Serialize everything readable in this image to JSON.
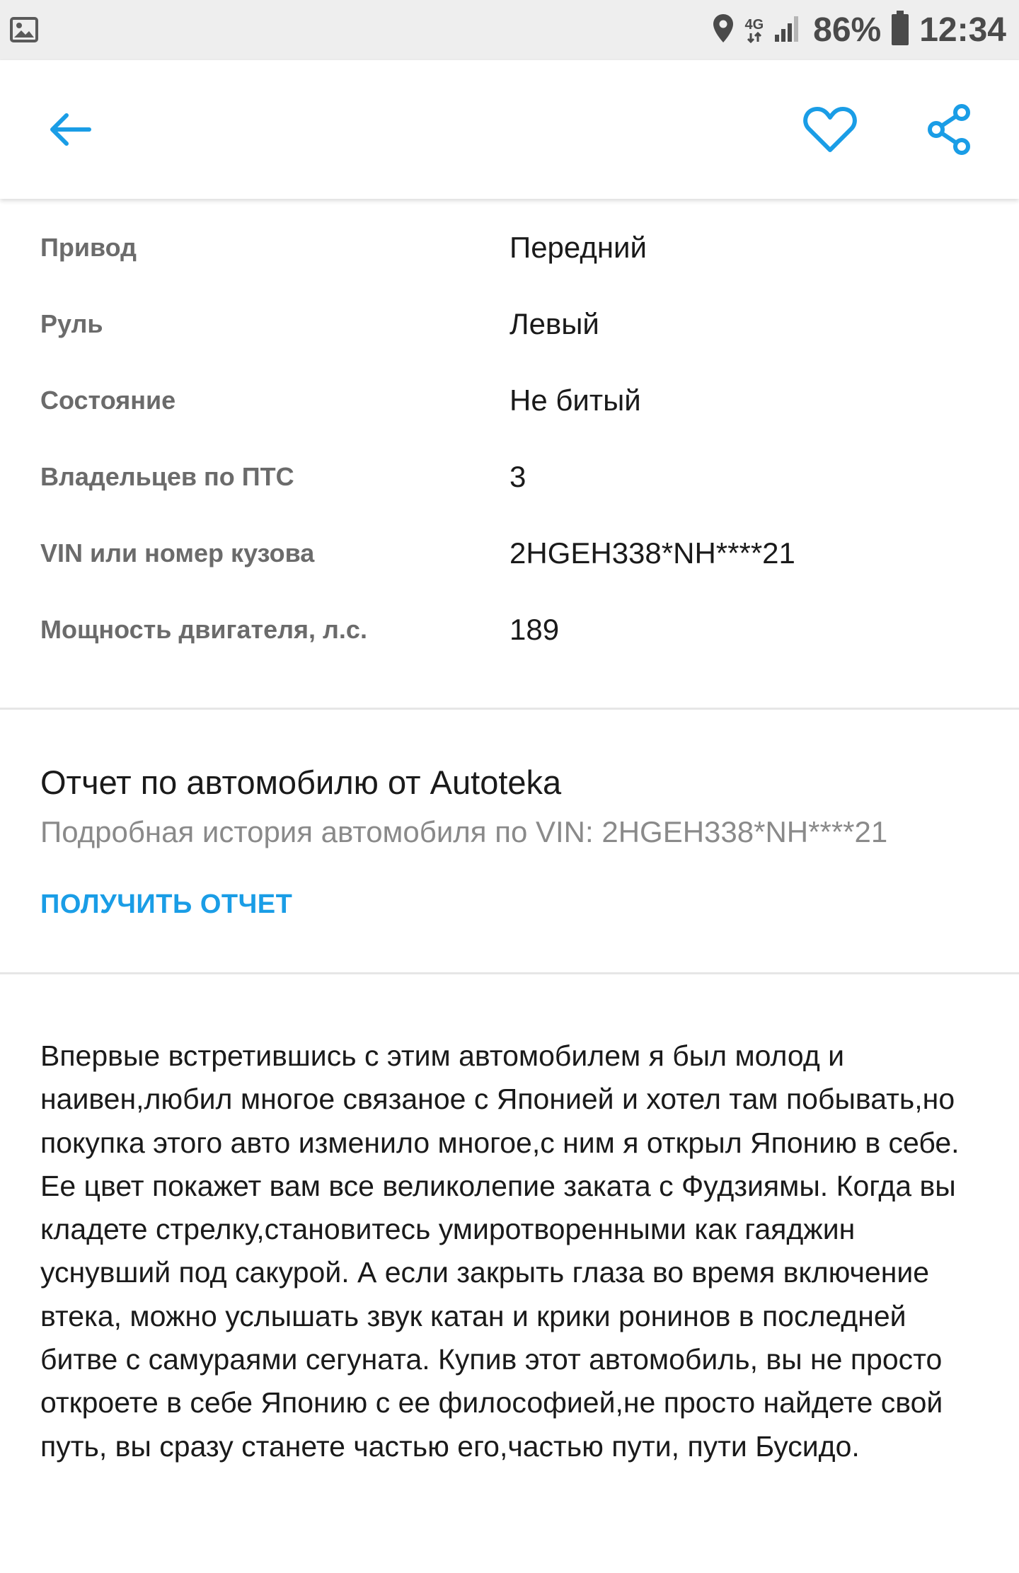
{
  "status_bar": {
    "battery": "86%",
    "time": "12:34",
    "network": "4G"
  },
  "app_bar": {
    "accent_color": "#1a9de6",
    "icons": [
      "arrow-back-icon",
      "heart-icon",
      "share-icon"
    ]
  },
  "specs": [
    {
      "label": "Привод",
      "value": "Передний"
    },
    {
      "label": "Руль",
      "value": "Левый"
    },
    {
      "label": "Состояние",
      "value": "Не битый"
    },
    {
      "label": "Владельцев по ПТС",
      "value": "3"
    },
    {
      "label": "VIN или номер кузова",
      "value": "2HGEH338*NH****21"
    },
    {
      "label": "Мощность двигателя, л.с.",
      "value": "189"
    }
  ],
  "report": {
    "title": "Отчет по автомобилю от Autoteka",
    "subtitle": "Подробная история автомобиля по VIN: 2HGEH338*NH****21",
    "action_label": "ПОЛУЧИТЬ ОТЧЕТ"
  },
  "description": {
    "paragraph_1": "Впервые встретившись с этим автомобилем я был молод и наивен,любил многое связаное с Японией и хотел там побывать,но покупка этого авто изменило многое,с ним я открыл Японию в себе.",
    "paragraph_2": "Ее цвет покажет вам все великолепие заката с Фудзиямы. Когда вы кладете стрелку,становитесь умиротворенными как гаяджин уснувший под сакурой. А если закрыть глаза во время включение втека, можно услышать звук катан и крики ронинов в последней битве с самураями сегуната. Купив этот автомобиль, вы не просто откроете в себе Японию с ее философией,не просто найдете свой путь, вы сразу станете частью его,частью пути, пути Бусидо."
  }
}
